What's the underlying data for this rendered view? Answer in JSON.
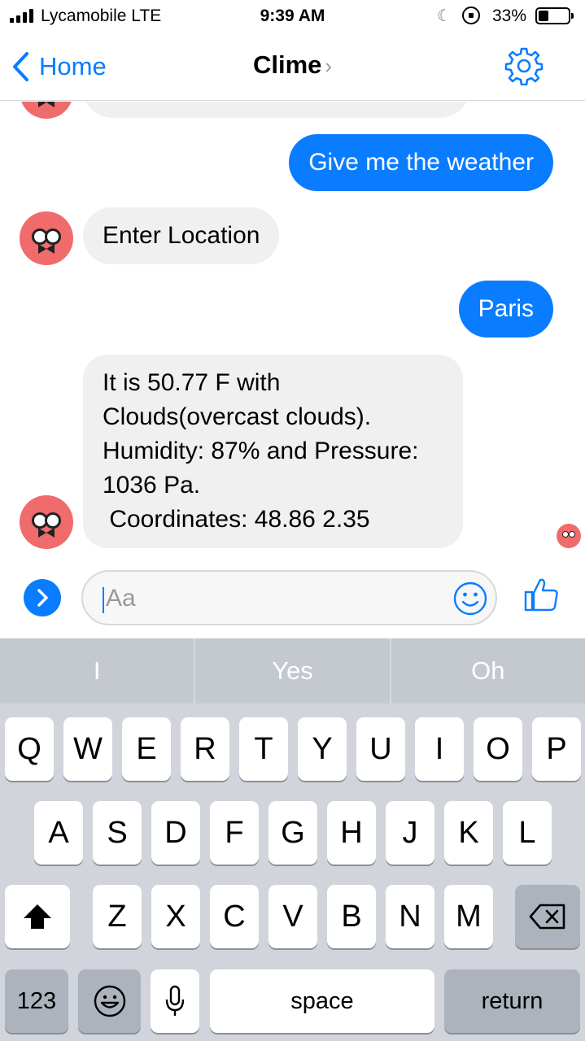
{
  "status_bar": {
    "carrier": "Lycamobile  LTE",
    "time": "9:39 AM",
    "battery": "33%",
    "signal_bars": 4,
    "battery_level": 0.33
  },
  "nav": {
    "back_label": "Home",
    "title": "Clime",
    "title_chevron": "›",
    "back_icon": "chevron-left-icon",
    "settings_icon": "gear-icon"
  },
  "messages": [
    {
      "sender": "user",
      "text": "Give me the weather"
    },
    {
      "sender": "bot",
      "text": "Enter Location"
    },
    {
      "sender": "user",
      "text": "Paris"
    },
    {
      "sender": "bot",
      "lines": [
        "It is 50.77 F with",
        "Clouds(overcast clouds).",
        "Humidity: 87% and Pressure:",
        "1036 Pa.",
        " Coordinates: 48.86 2.35"
      ]
    }
  ],
  "composer": {
    "placeholder": "Aa",
    "value": "",
    "expand_icon": "chevron-right-icon",
    "emoji_icon": "smiley-icon",
    "like_icon": "thumbs-up-icon"
  },
  "keyboard": {
    "suggestions": [
      "I",
      "Yes",
      "Oh"
    ],
    "row1": [
      "Q",
      "W",
      "E",
      "R",
      "T",
      "Y",
      "U",
      "I",
      "O",
      "P"
    ],
    "row2": [
      "A",
      "S",
      "D",
      "F",
      "G",
      "H",
      "J",
      "K",
      "L"
    ],
    "row3": [
      "Z",
      "X",
      "C",
      "V",
      "B",
      "N",
      "M"
    ],
    "numbers_label": "123",
    "space_label": "space",
    "return_label": "return",
    "shift_icon": "shift-icon",
    "delete_icon": "delete-icon",
    "emoji_key_icon": "emoji-icon",
    "mic_icon": "microphone-icon"
  },
  "colors": {
    "accent": "#0a7cff",
    "bot_avatar": "#f06b6b",
    "incoming_bubble": "#f0f0f0",
    "keyboard_bg": "#d1d4da"
  }
}
